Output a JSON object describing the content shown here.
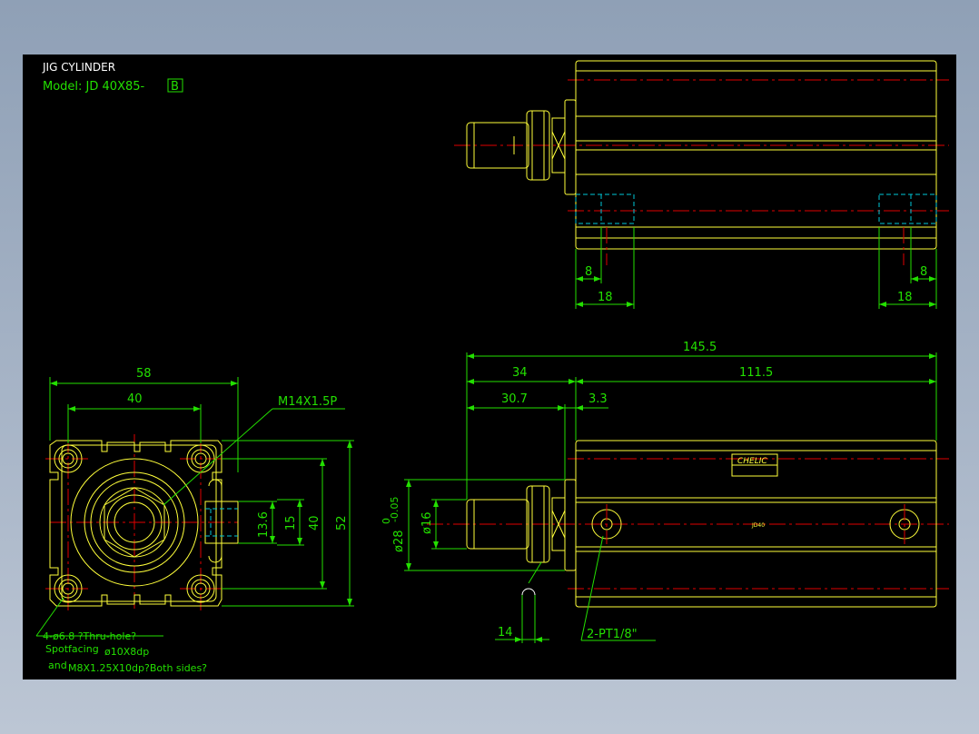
{
  "title": {
    "name": "JIG CYLINDER",
    "model_prefix": "Model: JD 40X85-",
    "model_suffix": "B"
  },
  "front_view": {
    "dim_overall_width": "58",
    "dim_bolt_pitch": "40",
    "thread_callout": "M14X1.5P",
    "dim_height_13_6": "13.6",
    "dim_height_15": "15",
    "dim_height_40": "40",
    "dim_height_52": "52",
    "note_line1": "4-ø6.8 ?Thru-hole?",
    "note_line2a": "Spotfacing",
    "note_line2b": "ø10X8dp",
    "note_line3a": "and",
    "note_line3b": "M8X1.25X10dp?Both sides?"
  },
  "top_view": {
    "dim_left_8": "8",
    "dim_left_18": "18",
    "dim_right_8": "8",
    "dim_right_18": "18"
  },
  "side_view": {
    "dim_total": "145.5",
    "dim_34": "34",
    "dim_111_5": "111.5",
    "dim_30_7": "30.7",
    "dim_3_3": "3.3",
    "dim_rod_dia": "ø16",
    "dim_bush_dia": "ø28",
    "dim_bush_tol_top": "0",
    "dim_bush_tol_bottom": "-0.05",
    "dim_wrench_14": "14",
    "port_callout": "2-PT1/8\"",
    "label_brand": "CHELIC",
    "label_small": "JD40"
  },
  "colors": {
    "background": "#000000",
    "dimension": "#23e000",
    "outline": "#ffff3a",
    "centerline": "#e00000",
    "hidden": "#00c8d8",
    "titletext": "#ffffff"
  }
}
